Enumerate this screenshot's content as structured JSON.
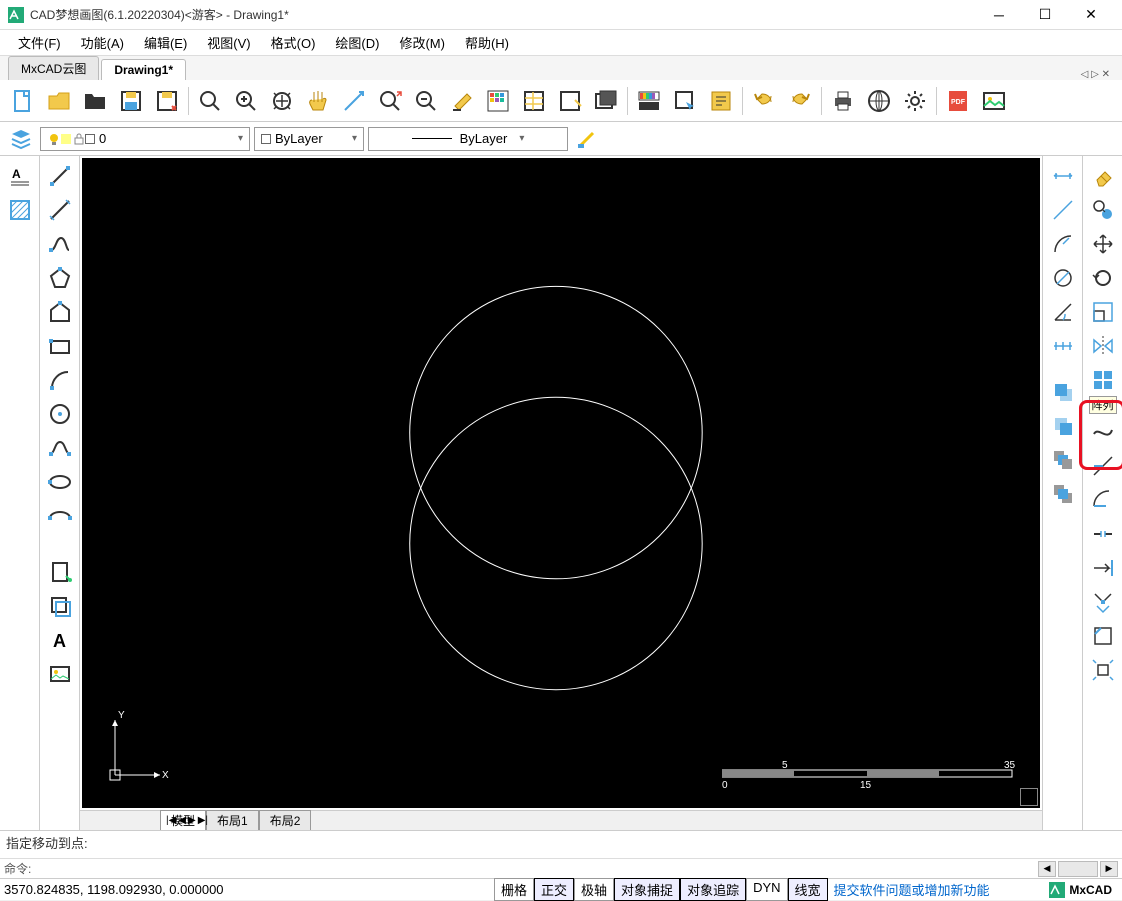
{
  "window": {
    "title": "CAD梦想画图(6.1.20220304)<游客> - Drawing1*"
  },
  "menus": [
    "文件(F)",
    "功能(A)",
    "编辑(E)",
    "视图(V)",
    "格式(O)",
    "绘图(D)",
    "修改(M)",
    "帮助(H)"
  ],
  "docTabs": {
    "items": [
      "MxCAD云图",
      "Drawing1*"
    ],
    "active": 1
  },
  "layerCombo": "0",
  "colorCombo": "ByLayer",
  "linetypeCombo": "ByLayer",
  "layoutTabs": {
    "items": [
      "模型",
      "布局1",
      "布局2"
    ],
    "active": 0
  },
  "commandHistory": "指定移动到点:",
  "commandPrompt": "命令:",
  "coords": "3570.824835, 1198.092930, 0.000000",
  "statusToggles": [
    {
      "label": "栅格",
      "active": false
    },
    {
      "label": "正交",
      "active": true
    },
    {
      "label": "极轴",
      "active": false
    },
    {
      "label": "对象捕捉",
      "active": true
    },
    {
      "label": "对象追踪",
      "active": true
    },
    {
      "label": "DYN",
      "active": false
    },
    {
      "label": "线宽",
      "active": true
    }
  ],
  "statusLink": "提交软件问题或增加新功能",
  "brand": "MxCAD",
  "tooltip": "阵列",
  "ruler": {
    "ticks": [
      "5",
      "35",
      "0",
      "15"
    ]
  },
  "axes": {
    "x": "X",
    "y": "Y"
  }
}
